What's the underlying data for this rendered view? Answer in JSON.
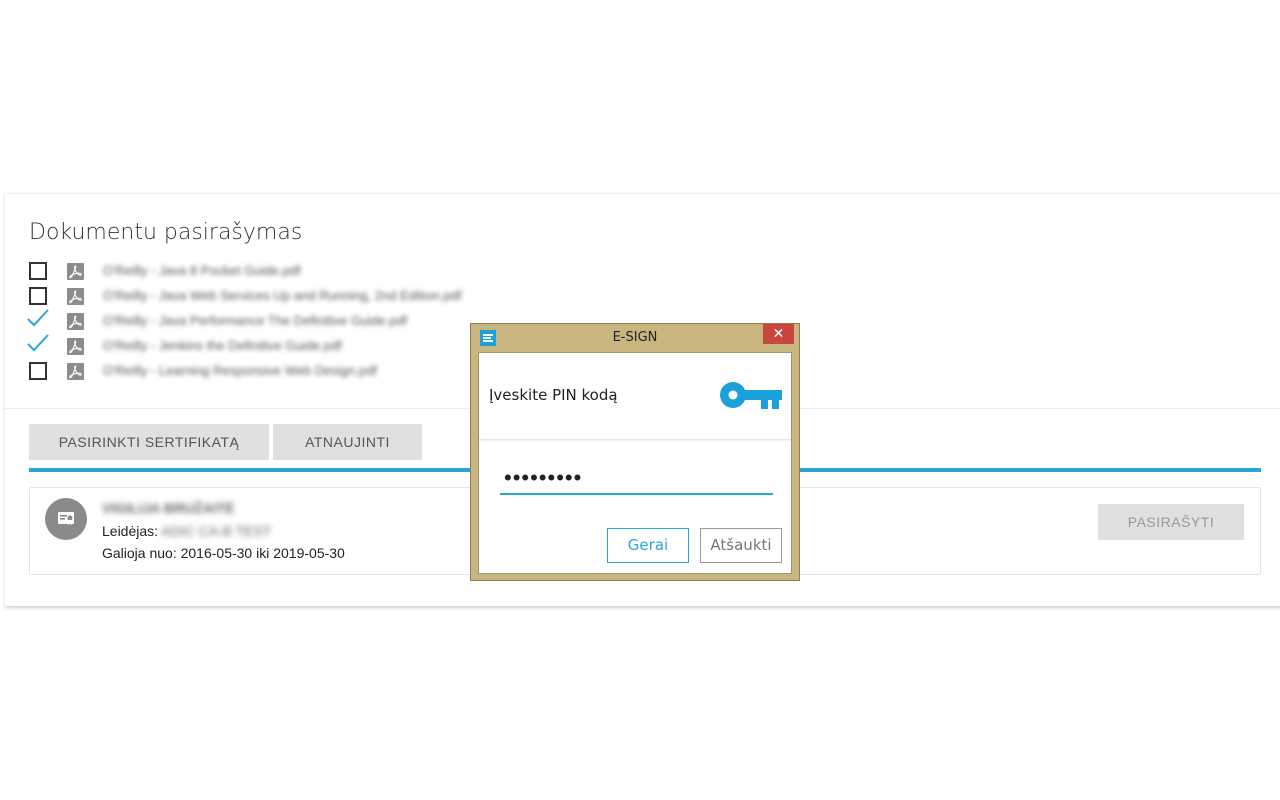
{
  "page": {
    "title": "Dokumentu pasirašymas"
  },
  "documents": [
    {
      "name": "O'Reilly - Java 8 Pocket Guide.pdf",
      "checked": false
    },
    {
      "name": "O'Reilly - Java Web Services Up and Running, 2nd Edition.pdf",
      "checked": false
    },
    {
      "name": "O'Reilly - Java Performance The Definitive Guide.pdf",
      "checked": true
    },
    {
      "name": "O'Reilly - Jenkins the Definitive Guide.pdf",
      "checked": true
    },
    {
      "name": "O'Reilly - Learning Responsive Web Design.pdf",
      "checked": false
    }
  ],
  "actions": {
    "select_certificate": "PASIRINKTI SERTIFIKATĄ",
    "refresh": "ATNAUJINTI",
    "sign": "PASIRAŠYTI"
  },
  "progress": {
    "fraction": 1.0
  },
  "certificate": {
    "owner": "VIGILIJA BRUŽAITĖ",
    "issuer_label": "Leidėjas:",
    "issuer_value": "ADIC CA-B TEST",
    "validity": "Galioja nuo: 2016-05-30 iki 2019-05-30"
  },
  "dialog": {
    "title": "E-SIGN",
    "close_glyph": "✕",
    "prompt": "Įveskite PIN kodą",
    "pin_value": "•••••••••",
    "ok_label": "Gerai",
    "cancel_label": "Atšaukti"
  },
  "colors": {
    "accent": "#2aa7d0",
    "dialog_frame": "#c8b57f",
    "close_red": "#c7463d",
    "key_icon": "#1aa1dc"
  },
  "icons": {
    "document": "pdf-icon",
    "checkmark": "checkmark-icon",
    "certificate": "certificate-icon",
    "key": "key-icon",
    "app_logo": "esign-logo-icon",
    "close": "close-icon"
  }
}
